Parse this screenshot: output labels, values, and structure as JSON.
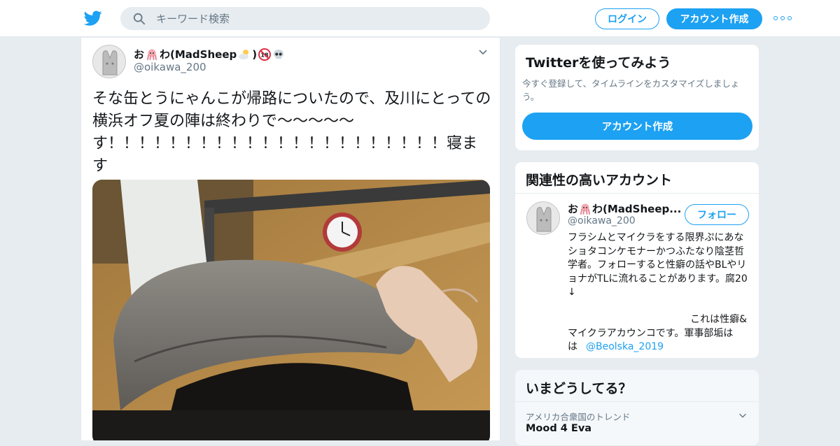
{
  "header": {
    "search_placeholder": "キーワード検索",
    "login_label": "ログイン",
    "signup_label": "アカウント作成",
    "brand_color": "#1da1f2"
  },
  "tweet": {
    "author_name": "お",
    "author_name_2": "わ(MadSheep",
    "author_name_3": ")",
    "handle": "@oikawa_200",
    "text": "そな缶とうにゃんこが帰路についたので、及川にとっての横浜オフ夏の陣は終わりで～～～～～す！！！！！！！！！！！！！！！！！！！！！！寝ます",
    "emoji_icons": [
      "octopus-icon",
      "sun-behind-cloud-icon",
      "no-one-under-18-icon",
      "skull-icon"
    ]
  },
  "sidebar": {
    "try_card": {
      "title": "Twitterを使ってみよう",
      "description": "今すぐ登録して、タイムラインをカスタマイズしましょう。",
      "button_label": "アカウント作成"
    },
    "related": {
      "title": "関連性の高いアカウント",
      "name": "お",
      "name_2": "わ(MadSheep...",
      "handle": "@oikawa_200",
      "follow_label": "フォロー",
      "bio_1": "フラシムとマイクラをする限界ぷにあなショタコンケモナーかつふたなり陰茎哲学者。フォローすると性癖の話やBLやリョナがTLに流れることがあります。腐20↓",
      "bio_2": "これは性癖&",
      "bio_3": "マイクラアカウンコです。軍事部垢は",
      "bio_link": "@Beolska_2019"
    },
    "trends": {
      "title": "いまどうしてる？",
      "context": "アメリカ合衆国のトレンド",
      "trend_name": "Mood 4 Eva"
    }
  }
}
